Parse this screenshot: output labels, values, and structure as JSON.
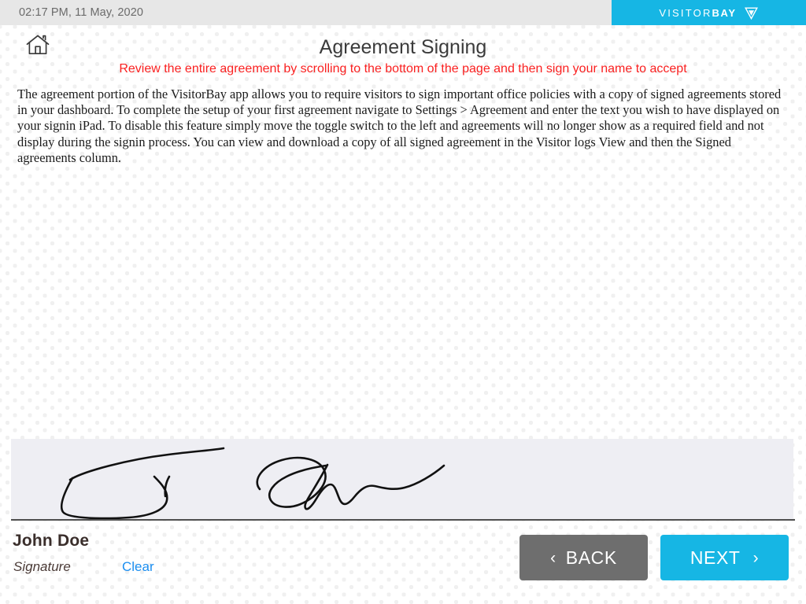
{
  "statusbar": {
    "time": "02:17 PM, 11 May, 2020",
    "brand_light": "VISITOR",
    "brand_bold": "BAY",
    "brand_mark_icon": "triangle-v-logo-icon",
    "brand_color": "#16b6e4",
    "bar_color": "#e7e7e7"
  },
  "header": {
    "home_icon": "home-icon",
    "title": "Agreement Signing",
    "subtitle": "Review the entire agreement by scrolling to the bottom of the page and then sign your name to accept",
    "subtitle_color": "#fa2020",
    "title_color": "#3b3b3b"
  },
  "agreement": {
    "body": "The agreement portion of the VisitorBay app allows you to require visitors to sign important office policies with a copy of signed agreements stored in your dashboard. To complete the setup of your first agreement navigate to Settings > Agreement and enter the text you wish to have displayed on your signin iPad. To disable this feature simply move the toggle switch to the left and agreements will no longer show as a required field and not display during the signin process. You can view and download a copy of all signed agreement in the Visitor logs View and then the Signed agreements column."
  },
  "signature": {
    "pad_icon": "signature-drawing",
    "pad_color": "#eeeef3",
    "ink_color": "#111111",
    "name": "John Doe",
    "label": "Signature",
    "clear_label": "Clear",
    "clear_color": "#1b8ef0"
  },
  "footer": {
    "back_label": "BACK",
    "back_icon": "chevron-left-icon",
    "back_chevron": "‹",
    "back_color": "#6e6e6e",
    "next_label": "NEXT",
    "next_icon": "chevron-right-icon",
    "next_chevron": "›",
    "next_color": "#16b6e4"
  }
}
